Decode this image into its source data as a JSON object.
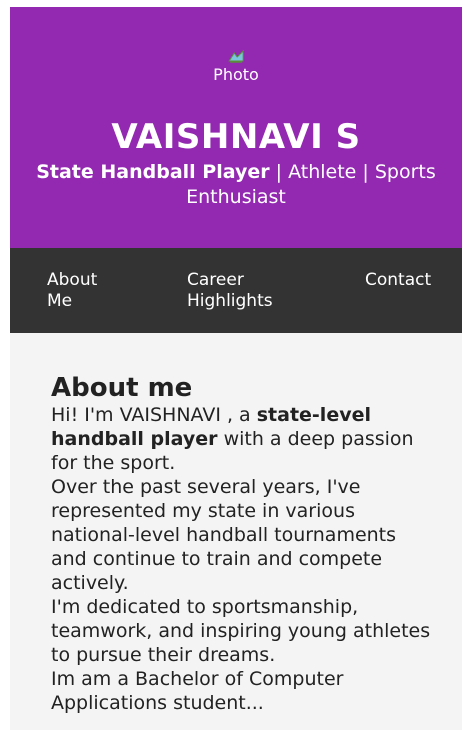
{
  "colors": {
    "header_bg": "#9229b0",
    "nav_bg": "#333333",
    "content_bg": "#f4f4f4"
  },
  "header": {
    "photo": {
      "icon": "broken-image-icon",
      "alt": "Photo"
    },
    "name": "VAISHNAVI S",
    "tagline": {
      "bold": "State Handball Player",
      "rest": " | Athlete | Sports Enthusiast"
    }
  },
  "nav": {
    "items": [
      {
        "label": "About Me"
      },
      {
        "label": "Career Highlights"
      },
      {
        "label": "Contact"
      }
    ]
  },
  "about": {
    "heading": "About me",
    "intro_prefix": "Hi! I'm VAISHNAVI , a ",
    "intro_bold": "state-level handball player",
    "intro_suffix": " with a deep passion for the sport.",
    "para2": "Over the past several years, I've represented my state in various national-level handball tournaments and continue to train and compete actively.",
    "para3": "I'm dedicated to sportsmanship, teamwork, and inspiring young athletes to pursue their dreams.",
    "para4": "Im am a Bachelor of Computer Applications student..."
  }
}
